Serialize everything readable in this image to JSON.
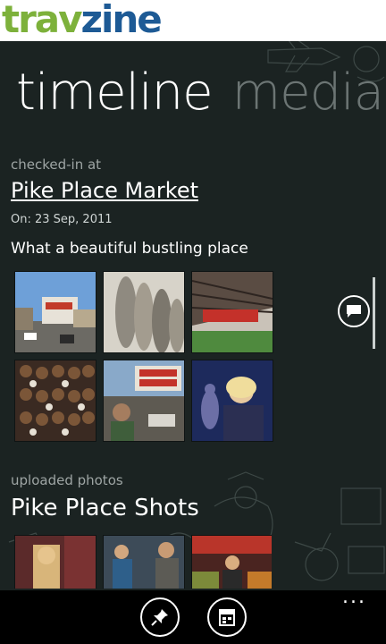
{
  "brand": {
    "name_part1": "trav",
    "name_part2": "zine"
  },
  "pivot": {
    "active": "timeline",
    "next": "media"
  },
  "checkin": {
    "label": "checked-in at",
    "place": "Pike Place Market",
    "date": "On: 23 Sep, 2011",
    "comment": "What a beautiful bustling place"
  },
  "uploads": {
    "label": "uploaded photos",
    "title": "Pike Place Shots"
  },
  "icons": {
    "comment": "comment-bubble-icon",
    "pin": "pin-icon",
    "calendar": "calendar-icon"
  },
  "appbar": {
    "more": "..."
  },
  "colors": {
    "background": "#1b2322",
    "logo_green": "#7db13b",
    "logo_blue": "#1d5a95"
  }
}
